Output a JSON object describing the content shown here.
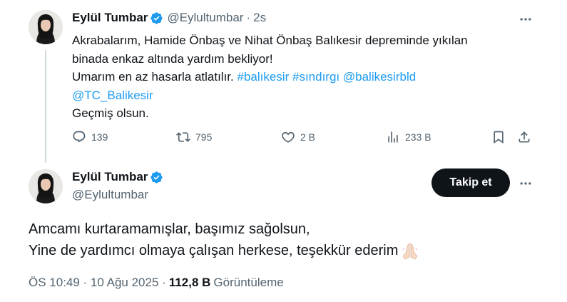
{
  "colors": {
    "text": "#0f1419",
    "secondary": "#536471",
    "link": "#1d9bf0",
    "verified": "#1d9bf0",
    "thread_line": "#cfd9de",
    "follow_bg": "#0f1419"
  },
  "tweet1": {
    "display_name": "Eylül Tumbar",
    "handle": "@Eylultumbar",
    "separator": "·",
    "time": "2s",
    "text_line1": "Akrabalarım, Hamide Önbaş ve Nihat Önbaş Balıkesir depreminde yıkılan",
    "text_line2": "binada enkaz altında yardım bekliyor!",
    "text_line3_prefix": "Umarım en az hasarla atlatılır. ",
    "hashtag1": "#balıkesir",
    "hashtag2": "#sındırgı",
    "mention1": "@balikesirbld",
    "mention2": "@TC_Balikesir",
    "text_line5": "Geçmiş olsun.",
    "actions": {
      "replies": "139",
      "reposts": "795",
      "likes": "2 B",
      "views": "233 B"
    },
    "icons": [
      "reply-icon",
      "repost-icon",
      "like-icon",
      "views-icon",
      "bookmark-icon",
      "share-icon",
      "more-icon"
    ]
  },
  "tweet2": {
    "display_name": "Eylül Tumbar",
    "handle": "@Eylultumbar",
    "follow_label": "Takip et",
    "text_line1": "Amcamı kurtaramamışlar, başımız sağolsun,",
    "text_line2": "Yine de yardımcı olmaya çalışan herkese, teşekkür ederim",
    "emoji_icon": "folded-hands-icon",
    "timestamp": "ÖS 10:49 · 10 Ağu 2025 ·",
    "views_count": "112,8 B",
    "views_label": "Görüntüleme"
  }
}
